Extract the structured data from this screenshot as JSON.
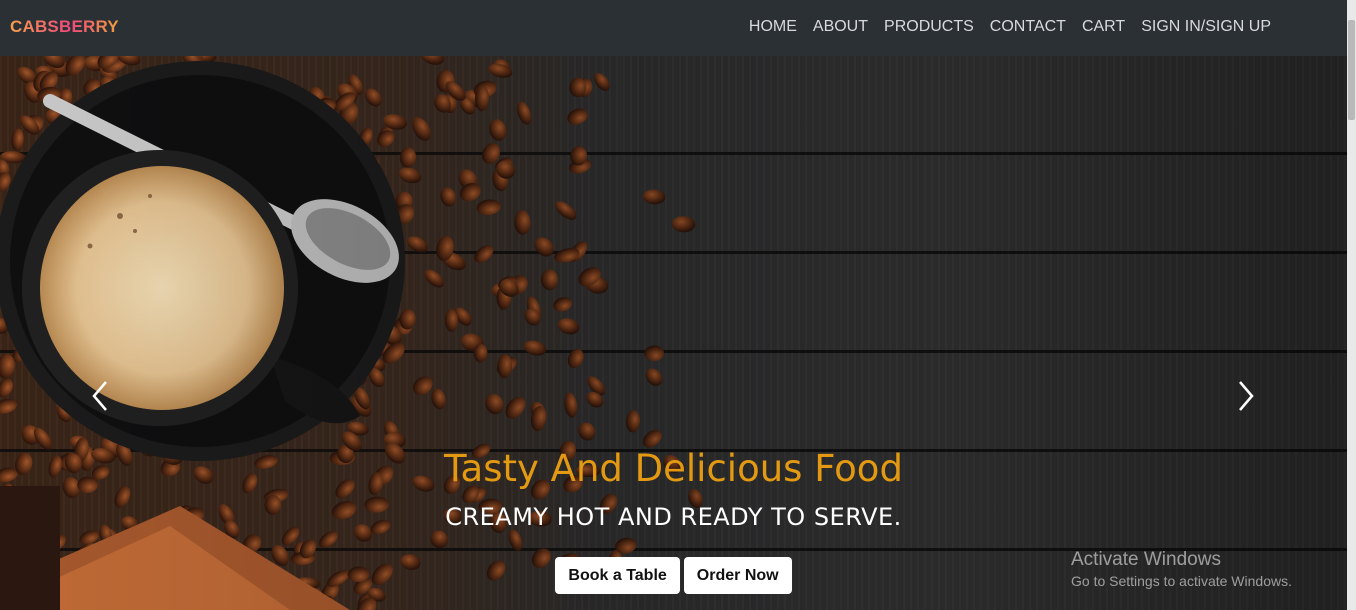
{
  "navbar": {
    "brand": "CABSBERRY",
    "links": [
      "HOME",
      "ABOUT",
      "PRODUCTS",
      "CONTACT",
      "CART",
      "SIGN IN/SIGN UP"
    ]
  },
  "hero": {
    "title": "Tasty And Delicious Food",
    "subtitle": "CREAMY HOT AND READY TO SERVE.",
    "buttons": [
      "Book a Table",
      "Order Now"
    ],
    "prev_icon": "chevron-left-icon",
    "next_icon": "chevron-right-icon"
  },
  "watermark": {
    "title": "Activate Windows",
    "subtitle": "Go to Settings to activate Windows."
  },
  "colors": {
    "navbar_bg": "#2b3035",
    "title": "#e39a12",
    "brand_gradient": [
      "#f6a04d",
      "#f04a7a",
      "#f0a040"
    ]
  }
}
